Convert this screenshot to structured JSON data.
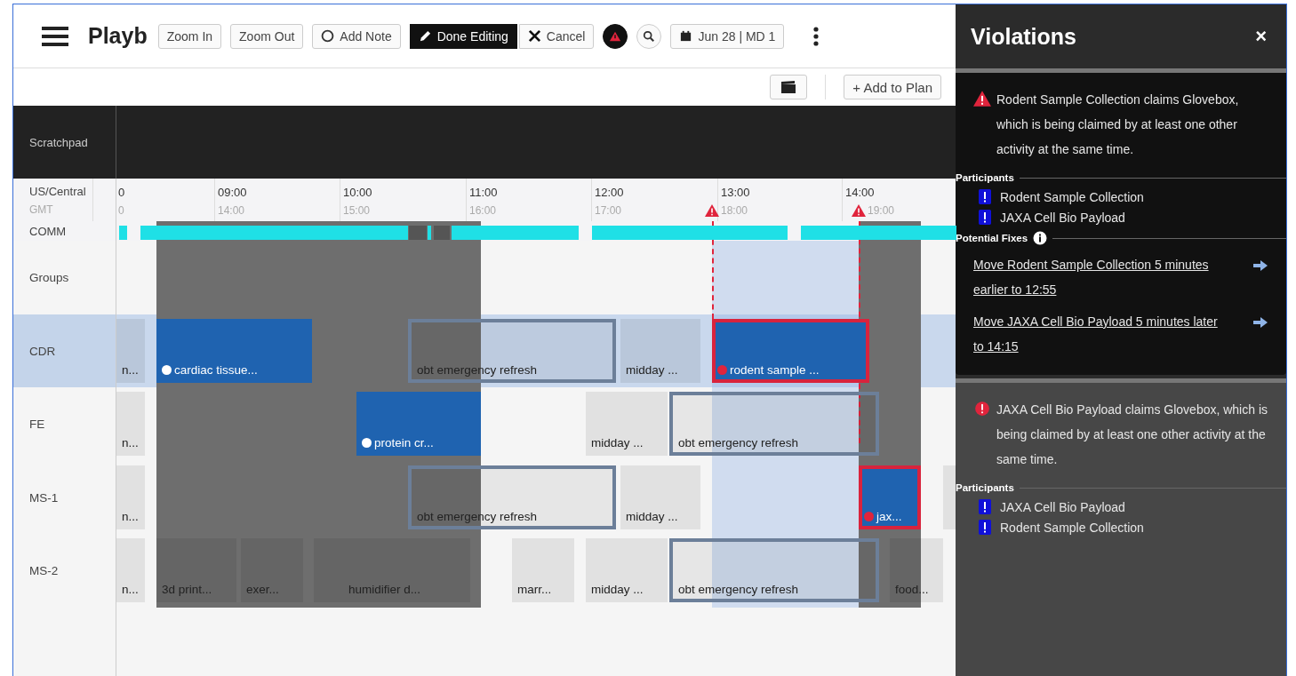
{
  "toolbar": {
    "title": "Playb",
    "buttons": [
      {
        "kind": "plain",
        "label": "Zoom In"
      },
      {
        "kind": "plain",
        "label": "Zoom Out"
      },
      {
        "kind": "note",
        "label": "Add Note"
      },
      {
        "kind": "primary",
        "label": "Done Editing"
      },
      {
        "kind": "cancel",
        "label": "Cancel"
      }
    ],
    "date_button": "Jun 28 | MD 1"
  },
  "subtoolbar": {
    "add_button": "+ Add to Plan"
  },
  "scratchpad": {
    "label": "Scratchpad"
  },
  "timezones": [
    {
      "label": "US/Central",
      "ticks": [
        "0",
        "09:00",
        "10:00",
        "11:00",
        "12:00",
        "13:00",
        "14:00"
      ]
    },
    {
      "label": "GMT",
      "ticks": [
        "0",
        "14:00",
        "15:00",
        "16:00",
        "17:00",
        "18:00",
        "19:00"
      ]
    }
  ],
  "comm": {
    "label": "COMM"
  },
  "rows": [
    {
      "label": "Groups",
      "selected": false,
      "activities": []
    },
    {
      "label": "CDR",
      "selected": true,
      "activities": [
        {
          "label": "n...",
          "kind": "plain",
          "conflict": false
        },
        {
          "label": "cardiac tissue...",
          "kind": "highlighted",
          "conflict": false
        },
        {
          "label": "obt emergency refresh",
          "kind": "outlined",
          "conflict": false
        },
        {
          "label": "midday ...",
          "kind": "plain",
          "conflict": false
        },
        {
          "label": "rodent sample ...",
          "kind": "highlighted",
          "conflict": true
        }
      ]
    },
    {
      "label": "FE",
      "selected": false,
      "activities": [
        {
          "label": "n...",
          "kind": "plain",
          "conflict": false
        },
        {
          "label": "protein cr...",
          "kind": "highlighted",
          "conflict": false
        },
        {
          "label": "midday ...",
          "kind": "plain",
          "conflict": false
        },
        {
          "label": "obt emergency refresh",
          "kind": "outlined",
          "conflict": false
        }
      ]
    },
    {
      "label": "MS-1",
      "selected": false,
      "activities": [
        {
          "label": "n...",
          "kind": "plain",
          "conflict": false
        },
        {
          "label": "obt emergency refresh",
          "kind": "outlined",
          "conflict": false
        },
        {
          "label": "midday ...",
          "kind": "plain",
          "conflict": false
        },
        {
          "label": "jax...",
          "kind": "highlighted",
          "conflict": true
        },
        {
          "kind": "plain",
          "conflict": false
        }
      ]
    },
    {
      "label": "MS-2",
      "selected": false,
      "activities": [
        {
          "label": "n...",
          "kind": "plain",
          "conflict": false
        },
        {
          "label": "3d print...",
          "kind": "plain",
          "conflict": false
        },
        {
          "label": "exer...",
          "kind": "plain",
          "conflict": false
        },
        {
          "kind": "plain",
          "conflict": false
        },
        {
          "label": "humidifier d...",
          "kind": "plain",
          "conflict": false
        },
        {
          "label": "marr...",
          "kind": "plain",
          "conflict": false
        },
        {
          "label": "midday ...",
          "kind": "plain",
          "conflict": false
        },
        {
          "label": "obt emergency refresh",
          "kind": "outlined",
          "conflict": false
        },
        {
          "label": "food...",
          "kind": "plain",
          "conflict": false
        }
      ]
    }
  ],
  "panel": {
    "title": "Violations",
    "close": "×",
    "violations": [
      {
        "selected": true,
        "message": "Rodent Sample Collection claims Glovebox, which is being claimed by at least one other activity at the same time.",
        "participants_label": "Participants",
        "participants": [
          "Rodent Sample Collection",
          "JAXA Cell Bio Payload"
        ],
        "fixes_label": "Potential Fixes",
        "fixes": [
          "Move Rodent Sample Collection 5 minutes earlier to 12:55",
          "Move JAXA Cell Bio Payload 5 minutes later to 14:15"
        ]
      },
      {
        "selected": false,
        "message": "JAXA Cell Bio Payload claims Glovebox, which is being claimed by at least one other activity at the same time.",
        "participants_label": "Participants",
        "participants": [
          "JAXA Cell Bio Payload",
          "Rodent Sample Collection"
        ]
      }
    ]
  }
}
